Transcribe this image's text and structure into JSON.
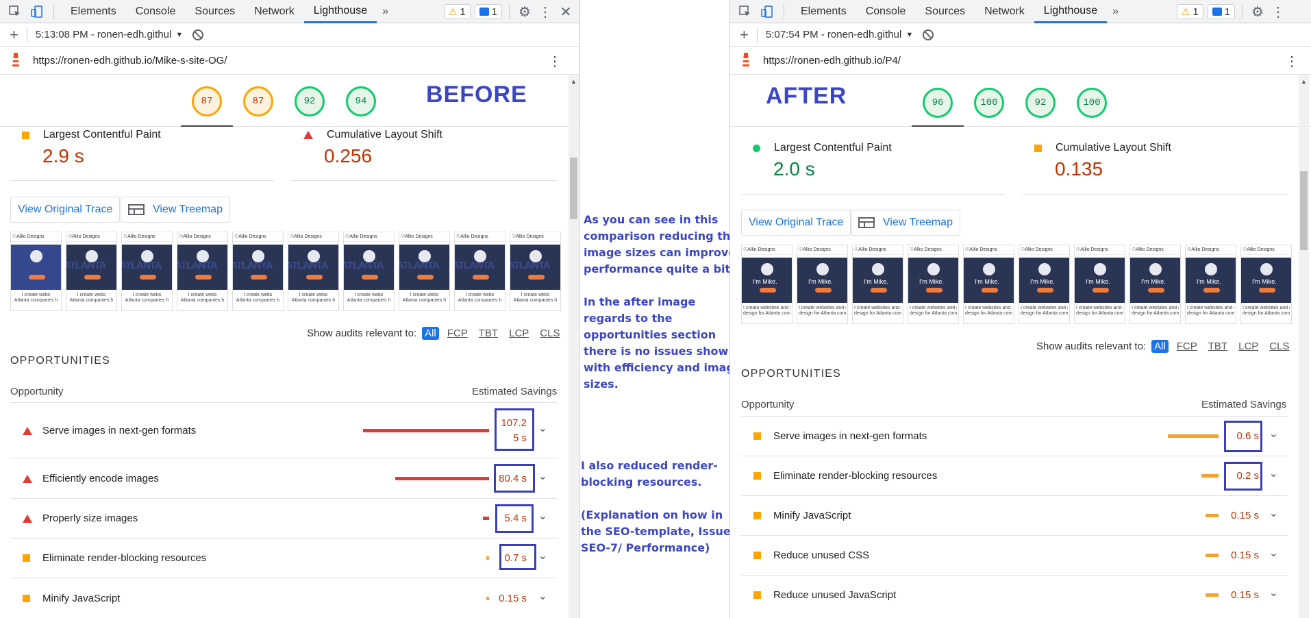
{
  "devtools": {
    "tabs": [
      "Elements",
      "Console",
      "Sources",
      "Network",
      "Lighthouse"
    ],
    "active_tab": "Lighthouse",
    "more": "»",
    "warning_count": "1",
    "message_count": "1",
    "warning_symbol": "⚠",
    "kebab": "⋮",
    "close": "✕",
    "gear": "⚙",
    "add": "+"
  },
  "before": {
    "report_time": "5:13:08 PM - ronen-edh.githul",
    "url": "https://ronen-edh.github.io/Mike-s-site-OG/",
    "label": "BEFORE",
    "scores": [
      "87",
      "87",
      "92",
      "94"
    ],
    "metrics": [
      {
        "label": "Largest Contentful Paint",
        "value": "2.9 s",
        "icon": "square-orange"
      },
      {
        "label": "Cumulative Layout Shift",
        "value": "0.256",
        "icon": "triangle-red"
      }
    ],
    "frame_header": "☉Allio Designs",
    "frame_text": [
      "I create webs",
      "Atlanta companies h"
    ],
    "frame_bigtext": "ATLANTA",
    "opportunities": [
      {
        "title": "Serve images in next-gen formats",
        "value": "107.2\n5 s",
        "value_line1": "107.2",
        "value_line2": "5 s",
        "severity": "fail",
        "bar": 0.98
      },
      {
        "title": "Efficiently encode images",
        "value": "80.4 s",
        "severity": "fail",
        "bar": 0.73
      },
      {
        "title": "Properly size images",
        "value": "5.4 s",
        "severity": "fail",
        "bar": 0.05
      },
      {
        "title": "Eliminate render-blocking resources",
        "value": "0.7 s",
        "severity": "average",
        "bar": 0.01
      },
      {
        "title": "Minify JavaScript",
        "value": "0.15 s",
        "severity": "average",
        "bar": 0.005
      }
    ]
  },
  "after": {
    "report_time": "5:07:54 PM - ronen-edh.githul",
    "url": "https://ronen-edh.github.io/P4/",
    "label": "AFTER",
    "scores": [
      "96",
      "100",
      "92",
      "100"
    ],
    "metrics": [
      {
        "label": "Largest Contentful Paint",
        "value": "2.0 s",
        "icon": "circle-green"
      },
      {
        "label": "Cumulative Layout Shift",
        "value": "0.135",
        "icon": "square-orange"
      }
    ],
    "frame_header": "☉Allio Designs",
    "frame_text": [
      "I create websites and graphic",
      "design for Atlanta companies"
    ],
    "frame_mike": "I'm Mike.",
    "opportunities": [
      {
        "title": "Serve images in next-gen formats",
        "value": "0.6 s",
        "severity": "average",
        "bar": 0.95
      },
      {
        "title": "Eliminate render-blocking resources",
        "value": "0.2 s",
        "severity": "average",
        "bar": 0.32
      },
      {
        "title": "Minify JavaScript",
        "value": "0.15 s",
        "severity": "average",
        "bar": 0.24
      },
      {
        "title": "Reduce unused CSS",
        "value": "0.15 s",
        "severity": "average",
        "bar": 0.24
      },
      {
        "title": "Reduce unused JavaScript",
        "value": "0.15 s",
        "severity": "average",
        "bar": 0.24
      }
    ]
  },
  "common": {
    "view_trace": "View Original Trace",
    "view_treemap": "View Treemap",
    "show_audits": "Show audits relevant to:",
    "filters": [
      "All",
      "FCP",
      "TBT",
      "LCP",
      "CLS"
    ],
    "opportunities_title": "OPPORTUNITIES",
    "col_opportunity": "Opportunity",
    "col_savings": "Estimated Savings"
  },
  "annotation": {
    "paragraph1": [
      "As you can see in this",
      "comparison reducing the",
      "image sizes can improves",
      "performance quite a bit."
    ],
    "paragraph2": [
      "In the after image",
      "regards to the",
      "opportunities section",
      "there is no issues show",
      "with efficiency and image",
      "sizes."
    ],
    "paragraph3": [
      "I also reduced render-",
      "blocking resources."
    ],
    "paragraph4": [
      "(Explanation on how in",
      "the SEO-template, Issue",
      "SEO-7/ Performance)"
    ]
  },
  "colors": {
    "fail": "#e53935",
    "average": "#ffa400",
    "pass": "#0cce6b",
    "accent": "#1a73e8",
    "annotation": "#3b46c5"
  }
}
